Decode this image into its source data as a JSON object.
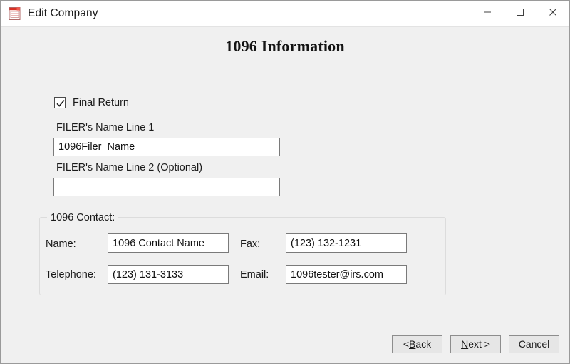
{
  "window": {
    "title": "Edit Company",
    "icon": "form-document-icon",
    "controls": {
      "minimize": "minimize-icon",
      "maximize": "maximize-icon",
      "close": "close-icon"
    }
  },
  "page": {
    "heading": "1096 Information"
  },
  "final_return": {
    "label": "Final Return",
    "checked": true
  },
  "filer": {
    "line1_label": "FILER's Name Line 1",
    "line1_value": "1096Filer  Name",
    "line2_label": "FILER's Name Line 2 (Optional)",
    "line2_value": "",
    "line2_placeholder": ""
  },
  "contact": {
    "group_title": "1096 Contact:",
    "name_label": "Name:",
    "name_value": "1096 Contact Name",
    "fax_label": "Fax:",
    "fax_value": "(123) 132-1231",
    "telephone_label": "Telephone:",
    "telephone_value": "(123) 131-3133",
    "email_label": "Email:",
    "email_value": "1096tester@irs.com"
  },
  "footer": {
    "back_prefix": "< ",
    "back_accel": "B",
    "back_suffix": "ack",
    "next_accel": "N",
    "next_suffix": "ext >",
    "cancel_label": "Cancel"
  },
  "colors": {
    "window_bg": "#f0f0f0",
    "titlebar_bg": "#ffffff",
    "field_bg": "#ffffff",
    "field_border": "#7a7a7a",
    "text": "#1b1b1b",
    "icon_accent": "#d93025",
    "button_bg": "#e6e6e6"
  }
}
